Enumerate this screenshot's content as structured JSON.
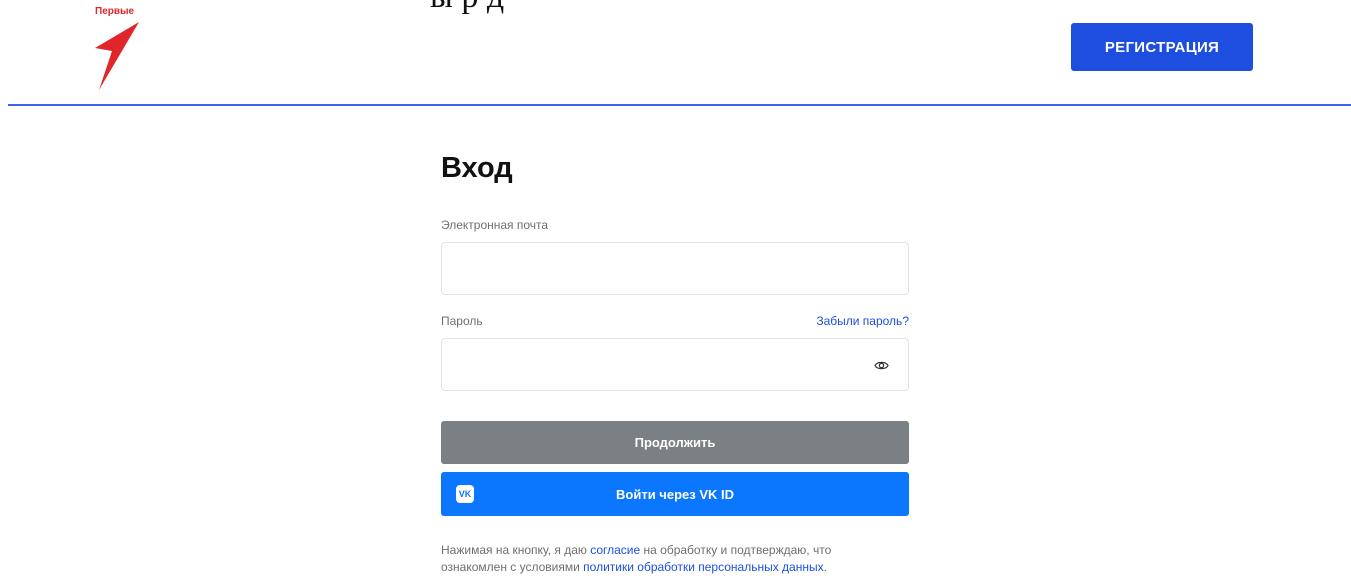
{
  "header": {
    "logo_text": "Первые",
    "cut_text": "ы   р         д",
    "register_label": "РЕГИСТРАЦИЯ"
  },
  "login": {
    "title": "Вход",
    "email_label": "Электронная почта",
    "email_value": "",
    "password_label": "Пароль",
    "password_value": "",
    "forgot_label": "Забыли пароль?",
    "continue_label": "Продолжить",
    "vk_label": "Войти через VK ID",
    "vk_icon_glyph": "VK"
  },
  "consent": {
    "part1": "Нажимая на кнопку, я даю ",
    "link1": "согласие",
    "part2": " на обработку и подтверждаю, что",
    "part3": "ознакомлен с условиями ",
    "link2": "политики обработки персональных данных",
    "part4": "."
  },
  "icons": {
    "logo": "red-arrow-logo-icon",
    "eye": "eye-icon",
    "vk": "vk-icon"
  },
  "colors": {
    "brand_red": "#e0262b",
    "primary_blue": "#1d4ee0",
    "vk_blue": "#0b77ff",
    "disabled_gray": "#7b8085"
  }
}
